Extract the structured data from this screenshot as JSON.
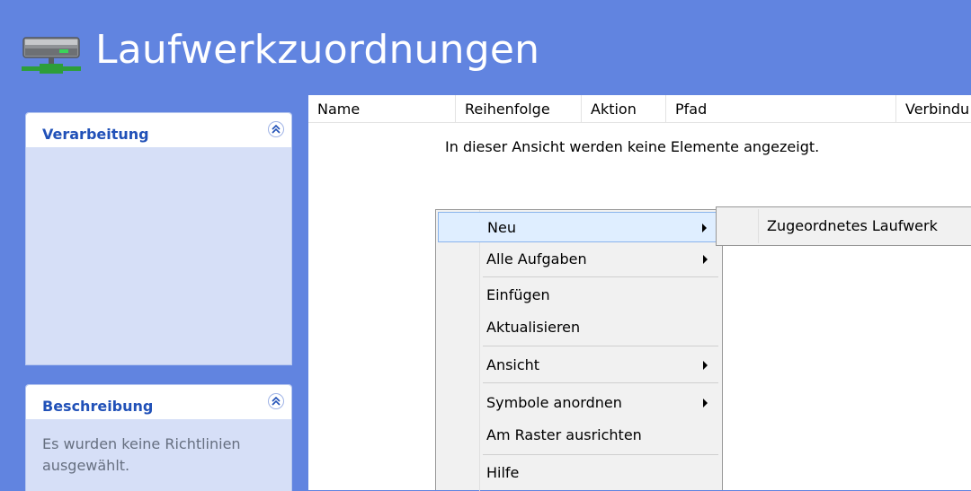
{
  "header": {
    "title": "Laufwerkzuordnungen",
    "icon": "network-drive-icon"
  },
  "tasks_panel": {
    "title": "Verarbeitung",
    "collapse_icon": "collapse-chevrons-icon"
  },
  "description_panel": {
    "title": "Beschreibung",
    "text": "Es wurden keine Richtlinien ausgewählt.",
    "collapse_icon": "collapse-chevrons-icon"
  },
  "listview": {
    "columns": [
      "Name",
      "Reihenfolge",
      "Aktion",
      "Pfad",
      "Verbindu"
    ],
    "empty_message": "In dieser Ansicht werden keine Elemente angezeigt."
  },
  "context_menu": {
    "items": [
      {
        "label": "Neu",
        "submenu": true,
        "highlighted": true
      },
      {
        "label": "Alle Aufgaben",
        "submenu": true
      },
      {
        "label": "Einfügen"
      },
      {
        "label": "Aktualisieren"
      },
      {
        "label": "Ansicht",
        "submenu": true
      },
      {
        "label": "Symbole anordnen",
        "submenu": true
      },
      {
        "label": "Am Raster ausrichten"
      },
      {
        "label": "Hilfe"
      }
    ]
  },
  "submenu": {
    "items": [
      {
        "label": "Zugeordnetes Laufwerk"
      }
    ]
  },
  "colors": {
    "background": "#6184e0",
    "panel_title": "#2151b8",
    "menu_highlight": "#dfeeff"
  }
}
